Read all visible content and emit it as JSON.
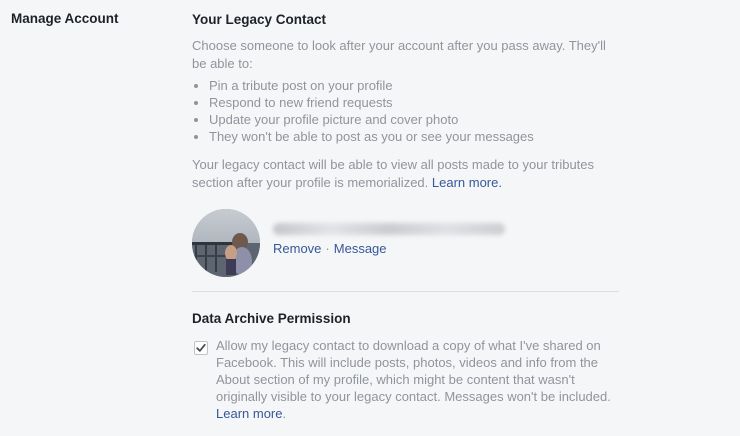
{
  "section": {
    "label": "Manage Account"
  },
  "legacy": {
    "heading": "Your Legacy Contact",
    "description": "Choose someone to look after your account after you pass away. They'll be able to:",
    "abilities": [
      "Pin a tribute post on your profile",
      "Respond to new friend requests",
      "Update your profile picture and cover photo",
      "They won't be able to post as you or see your messages"
    ],
    "note_text": "Your legacy contact will be able to view all posts made to your tributes section after your profile is memorialized.",
    "learn_more": "Learn more."
  },
  "contact": {
    "remove_label": "Remove",
    "separator": "·",
    "message_label": "Message"
  },
  "archive": {
    "heading": "Data Archive Permission",
    "checked": true,
    "text": "Allow my legacy contact to download a copy of what I've shared on Facebook. This will include posts, photos, videos and info from the About section of my profile, which might be content that wasn't originally visible to your legacy contact. Messages won't be included.",
    "learn_more": "Learn more",
    "trailing": "."
  },
  "colors": {
    "background": "#f5f6f7",
    "heading": "#1d2129",
    "body_text": "#90949c",
    "link": "#365899",
    "divider": "#dadde1"
  }
}
